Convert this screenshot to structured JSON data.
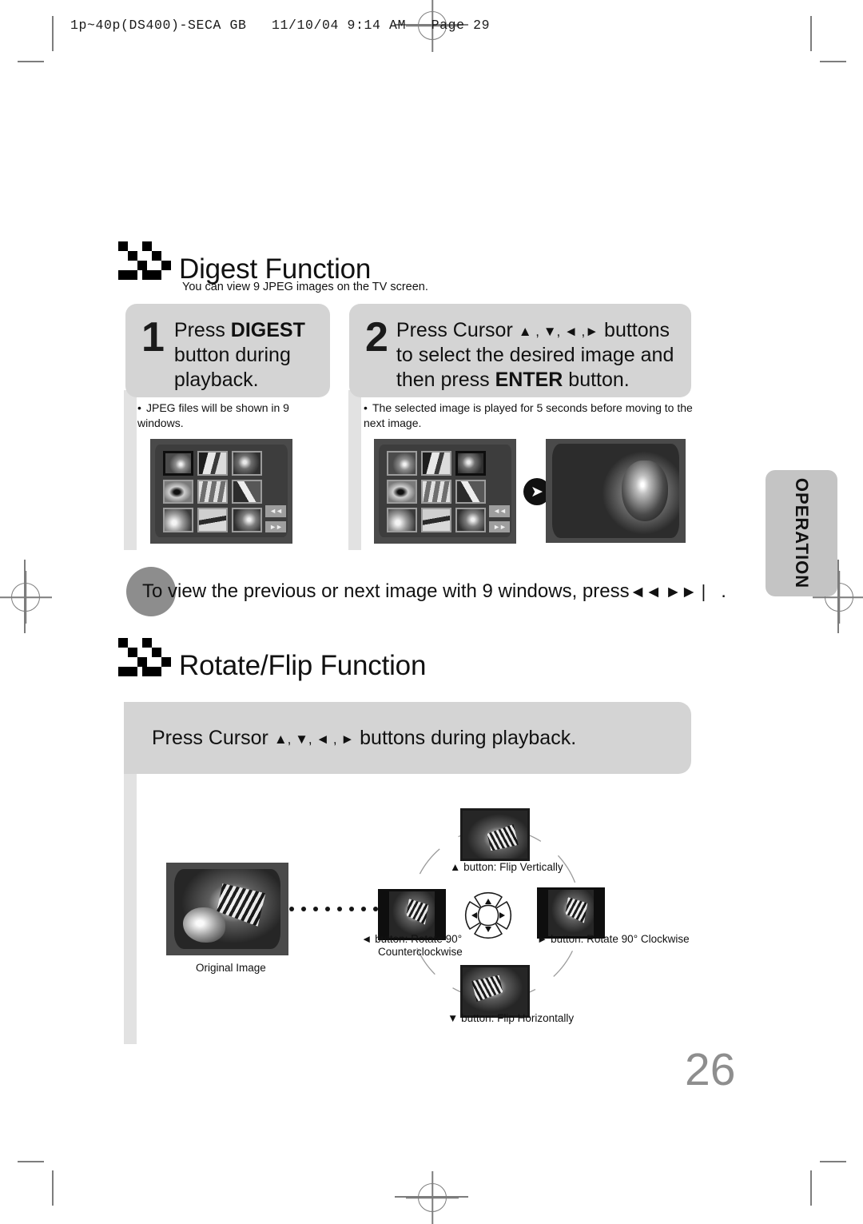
{
  "printer_slug": "1p~40p(DS400)-SECA GB   11/10/04 9:14 AM   Page 29",
  "side_tab": {
    "label": "OPERATION"
  },
  "page_number": "26",
  "sections": [
    {
      "id": "digest",
      "title": "Digest Function",
      "subtitle": "You can view 9 JPEG images on the TV screen.",
      "steps": [
        {
          "number": "1",
          "line1_pre": "Press ",
          "line1_bold": "DIGEST",
          "line2": "button during",
          "line3": "playback."
        },
        {
          "number": "2",
          "line1_pre": "Press Cursor ",
          "line1_arrows": "▲ , ▼, ◄ ,►",
          "line1_post": " buttons",
          "line2": "to select the desired image and",
          "line3_pre": "then press ",
          "line3_bold": "ENTER",
          "line3_post": " button."
        }
      ],
      "notes": [
        "JPEG files will be shown in 9 windows.",
        "The selected image is played for 5 seconds before moving to the next image."
      ],
      "tip": {
        "text_before": "To view the previous or next image with 9 windows, press",
        "icons": "◄◄ ►►❘",
        "text_after": "."
      }
    },
    {
      "id": "rotate-flip",
      "title": "Rotate/Flip Function",
      "banner": {
        "pre": "Press Cursor ",
        "arrows": "▲, ▼, ◄ , ►",
        "post": " buttons during playback."
      },
      "diagram": {
        "original_caption": "Original Image",
        "up_label": "▲ button: Flip Vertically",
        "down_label": "▼ button: Flip Horizontally",
        "left_label_line1": "◄ button: Rotate 90°",
        "left_label_line2": "Counterclockwise",
        "right_label": "► button: Rotate 90° Clockwise"
      }
    }
  ],
  "tv_digest_1": {
    "thumbnails": [
      "p1",
      "p2",
      "p3",
      "p4",
      "p5",
      "p6",
      "p7",
      "p8",
      "p9"
    ],
    "selected_index": 0,
    "nav_buttons": [
      "◄◄",
      "►►"
    ]
  },
  "tv_digest_2": {
    "thumbnails": [
      "p1",
      "p2",
      "p3",
      "p4",
      "p5",
      "p6",
      "p7",
      "p8",
      "p9"
    ],
    "selected_index": 2,
    "nav_buttons": [
      "◄◄",
      "►►"
    ]
  }
}
